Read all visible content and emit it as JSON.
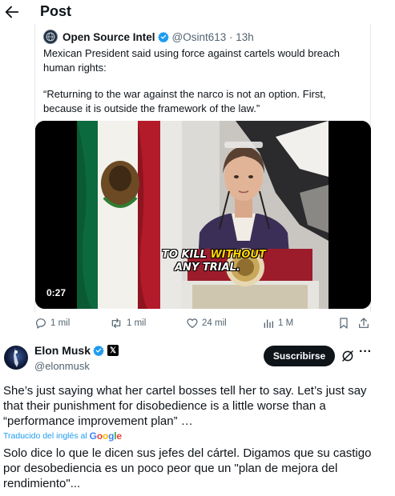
{
  "header": {
    "title": "Post"
  },
  "quoted_post": {
    "author_name": "Open Source Intel",
    "author_handle": "@Osint613 · 13h",
    "text_1": "Mexican President said using force against cartels would breach human rights:",
    "text_2": "“Returning to the war against the narco is not an option. First, because it is outside the framework of the law.”",
    "video": {
      "duration": "0:27",
      "caption_line1_white": "TO KILL ",
      "caption_line1_yellow": "WITHOUT",
      "caption_line2": "ANY TRIAL."
    }
  },
  "actions": {
    "replies": "1 mil",
    "reposts": "1 mil",
    "likes": "24 mil",
    "views": "1 M"
  },
  "post": {
    "author_name": "Elon Musk",
    "author_handle": "@elonmusk",
    "subscribe_label": "Suscribirse",
    "text": "She’s just saying what her cartel bosses tell her to say. Let’s just say that their punishment for disobedience is a little worse than a “performance improvement plan” …",
    "translated_label": "Traducido del inglés al",
    "translation_provider": "Google",
    "translation": "Solo dice lo que le dicen sus jefes del cártel. Digamos que su castigo por desobediencia es un poco peor que un \"plan de mejora del rendimiento\"..."
  },
  "colors": {
    "accent": "#1d9bf0",
    "verified": "#1d9bf0",
    "text_primary": "#0f1419",
    "text_secondary": "#536471",
    "caption_yellow": "#ffd400"
  },
  "icons": [
    "back-arrow-icon",
    "verified-icon",
    "play-video",
    "reply-icon",
    "repost-icon",
    "like-icon",
    "views-icon",
    "bookmark-icon",
    "share-icon",
    "x-logo-icon",
    "grok-icon",
    "more-icon"
  ]
}
